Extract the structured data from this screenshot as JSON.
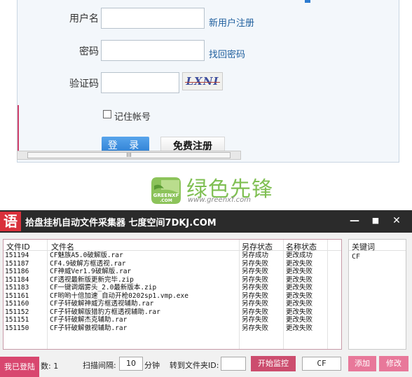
{
  "login": {
    "username_label": "用户名",
    "new_user_link": "新用户注册",
    "password_label": "密码",
    "recover_password_link": "找回密码",
    "captcha_label": "验证码",
    "captcha_text": "LXNI",
    "remember_label": "记住帐号",
    "login_button": "登 录",
    "free_register_button": "免费注册",
    "scroll_grip": "III"
  },
  "watermark": {
    "logo_text_top": "GREENXF",
    "logo_text_bottom": ".COM",
    "name": "绿色先锋",
    "url": "www.greenxf.com"
  },
  "app": {
    "icon_glyph": "语",
    "title": "拾盘挂机自动文件采集器 七度空间7DKJ.COM",
    "minimize_glyph": "—",
    "maximize_glyph": "■",
    "close_glyph": "✕",
    "columns": [
      "文件ID",
      "文件名",
      "另存状态",
      "名称状态"
    ],
    "rows": [
      {
        "id": "151194",
        "name": "CF魅族A5.0破解版.rar",
        "save": "另存成功",
        "name_status": "更改成功"
      },
      {
        "id": "151187",
        "name": "CF4.9破解方框透视.rar",
        "save": "另存失败",
        "name_status": "更改失败"
      },
      {
        "id": "151186",
        "name": "CF神威Ver1.9破解版.rar",
        "save": "另存失败",
        "name_status": "更改失败"
      },
      {
        "id": "151184",
        "name": "CF透视最新版更新完毕.zip",
        "save": "另存失败",
        "name_status": "更改失败"
      },
      {
        "id": "151183",
        "name": "CF一键调烟雾头_2.0最新版本.zip",
        "save": "另存失败",
        "name_status": "更改失败"
      },
      {
        "id": "151161",
        "name": "CF哟哟十倍加速_自动开枪0202sp1.vmp.exe",
        "save": "另存失败",
        "name_status": "更改失败"
      },
      {
        "id": "151160",
        "name": "CF子轩破解神威方框透视辅助.rar",
        "save": "另存失败",
        "name_status": "更改失败"
      },
      {
        "id": "151152",
        "name": "CF子轩破解版猎豹方框透视辅助.rar",
        "save": "另存失败",
        "name_status": "更改失败"
      },
      {
        "id": "151151",
        "name": "CF子轩破解杰克辅助.rar",
        "save": "另存失败",
        "name_status": "更改失败"
      },
      {
        "id": "151150",
        "name": "CF子轩破解傲视辅助.rar",
        "save": "另存失败",
        "name_status": "更改失败"
      }
    ],
    "keywords_header": "关键词",
    "keywords": [
      "CF"
    ],
    "count_label": "数: 1",
    "scan_interval_label": "扫描间隔:",
    "scan_interval_value": "10",
    "minutes_label": "分钟",
    "folder_id_label": "转到文件夹ID:",
    "folder_id_value": "",
    "start_button": "开始监控",
    "keyword_input_value": "CF",
    "add_button": "添加",
    "edit_button": "修改",
    "logged_in_badge": "我已登陆"
  }
}
